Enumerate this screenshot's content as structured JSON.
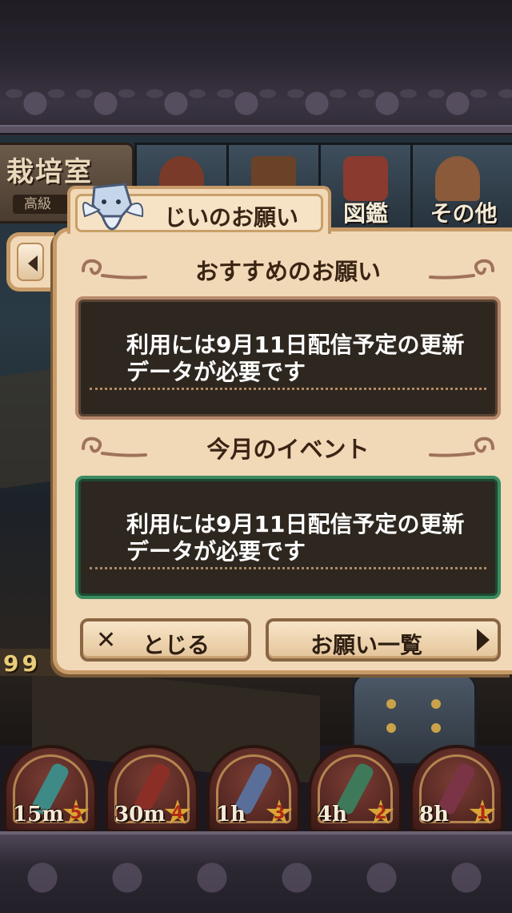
{
  "header": {
    "room_title": "栽培室",
    "room_sub": "高級",
    "tabs": [
      {
        "label": "",
        "icon": "door-icon"
      },
      {
        "label": "",
        "icon": "hat-icon"
      },
      {
        "label": "図鑑",
        "icon": "book-icon"
      },
      {
        "label": "その他",
        "icon": "door-other-icon"
      }
    ],
    "score": "99"
  },
  "dialog": {
    "title": "じいのお願い",
    "sections": [
      {
        "heading": "おすすめのお願い",
        "message": "利用には9月11日配信予定の更新データが必要です",
        "frame": "brown"
      },
      {
        "heading": "今月のイベント",
        "message": "利用には9月11日配信予定の更新データが必要です",
        "frame": "green"
      }
    ],
    "close_label": "とじる",
    "list_label": "お願い一覧"
  },
  "slots": [
    {
      "time": "15m",
      "rank": "5",
      "item_color": "#3e8a86",
      "icon": "bottle-icon"
    },
    {
      "time": "30m",
      "rank": "4",
      "item_color": "#8a2e26",
      "icon": "vial-red-icon"
    },
    {
      "time": "1h",
      "rank": "3",
      "item_color": "#5a6e9a",
      "icon": "vial-blue-icon"
    },
    {
      "time": "4h",
      "rank": "2",
      "item_color": "#3e7a5a",
      "icon": "vial-green-icon"
    },
    {
      "time": "8h",
      "rank": "1",
      "item_color": "#7a3446",
      "icon": "vial-purple-icon"
    }
  ],
  "colors": {
    "panel_border": "#b8896a",
    "event_border": "#3c8a62",
    "dialog_bg": "#f1d8b7"
  }
}
